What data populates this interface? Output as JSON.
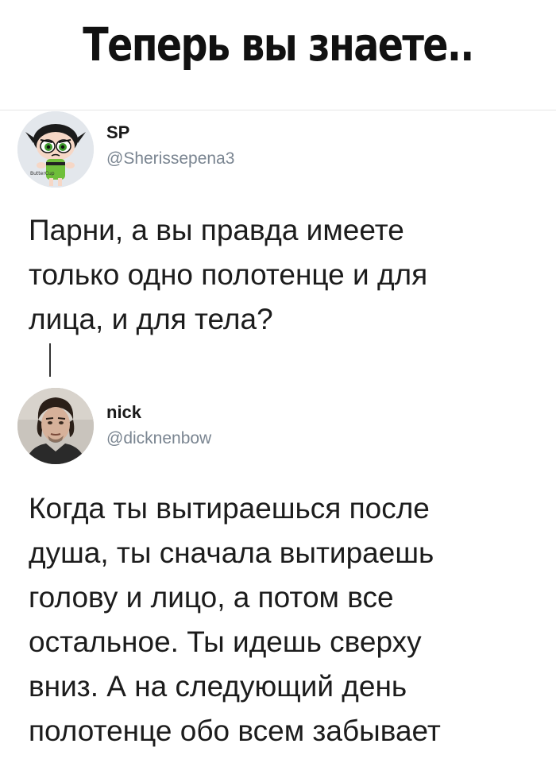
{
  "banner": {
    "title": "Теперь вы знаете.."
  },
  "tweets": [
    {
      "name": "SP",
      "handle": "@Sherissepena3",
      "text": "Парни, а вы правда имеете\nтолько одно полотенце и для\nлица, и для тела?",
      "avatar_icon": "powerpuff-girl-avatar",
      "avatar_caption": "ButterCup"
    },
    {
      "name": "nick",
      "handle": "@dicknenbow",
      "text": "Когда ты вытираешься после\nдуша, ты сначала вытираешь\nголову и лицо, а потом все\nостальное. Ты идешь сверху\nвниз. А на следующий день\nполотенце обо всем забывает",
      "avatar_icon": "man-portrait-avatar"
    }
  ],
  "colors": {
    "handle": "#7a8591",
    "text": "#1c1c1c",
    "accent_green": "#6fbf3a"
  }
}
